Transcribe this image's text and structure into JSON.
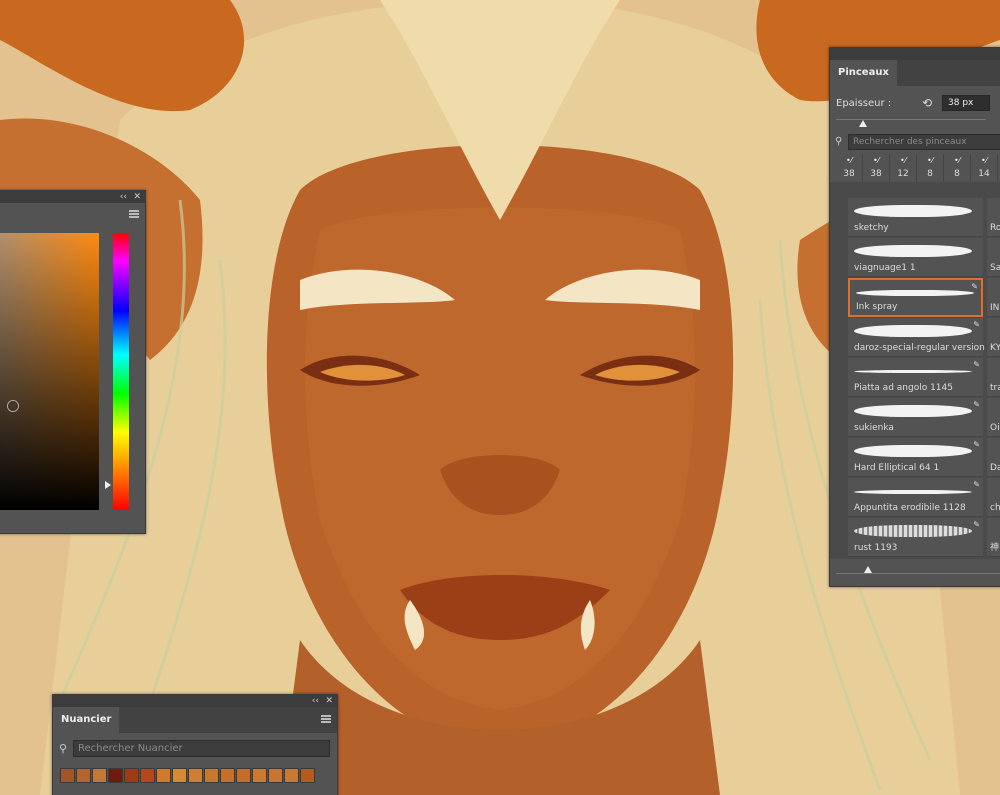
{
  "color_panel": {
    "collapse_glyph": "‹‹",
    "close_glyph": "✕"
  },
  "brush_panel": {
    "tab_label": "Pinceaux",
    "size_label": "Epaisseur :",
    "size_value": "38 px",
    "search_placeholder": "Rechercher des pinceaux",
    "recent_sizes": [
      "38",
      "38",
      "12",
      "8",
      "8",
      "14"
    ],
    "brushes": [
      {
        "name": "sketchy",
        "side": "Ro"
      },
      {
        "name": "viagnuage1 1",
        "side": "Sa"
      },
      {
        "name": "Ink spray",
        "side": "IN",
        "selected": true
      },
      {
        "name": "daroz-special-regular version",
        "side": "KY"
      },
      {
        "name": "Piatta ad angolo 1145",
        "side": "tra"
      },
      {
        "name": "sukienka",
        "side": "Oil"
      },
      {
        "name": "Hard Elliptical 64 1",
        "side": "Da"
      },
      {
        "name": "Appuntita erodibile 1128",
        "side": "ch"
      },
      {
        "name": "rust 1193",
        "side": "神"
      }
    ]
  },
  "swatch_panel": {
    "tab_label": "Nuancier",
    "search_placeholder": "Rechercher Nuancier",
    "collapse_glyph": "‹‹",
    "close_glyph": "✕",
    "swatches": [
      "#a0562a",
      "#b3652f",
      "#c27839",
      "#6e1a0e",
      "#9e3a18",
      "#b4471e",
      "#d27a2b",
      "#d68a34",
      "#cf7f33",
      "#c8772e",
      "#c5702a",
      "#c46d2b",
      "#cc7a2c",
      "#c77530",
      "#c87a35",
      "#b25c23"
    ]
  }
}
